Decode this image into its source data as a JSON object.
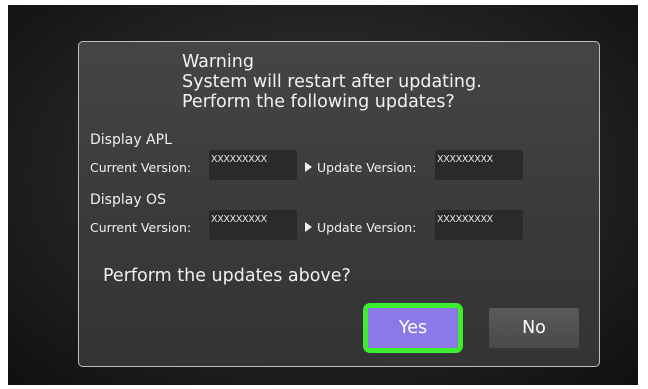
{
  "dialog": {
    "title_lines": [
      "Warning",
      "System will restart after updating.",
      "Perform the following updates?"
    ],
    "sections": [
      {
        "label": "Display APL",
        "current_version_label": "Current Version:",
        "current_version_value": "XXXXXXXXX",
        "update_version_label": "Update Version:",
        "update_version_value": "XXXXXXXXX"
      },
      {
        "label": "Display OS",
        "current_version_label": "Current Version:",
        "current_version_value": "XXXXXXXXX",
        "update_version_label": "Update Version:",
        "update_version_value": "XXXXXXXXX"
      }
    ],
    "question": "Perform the updates above?",
    "yes_label": "Yes",
    "no_label": "No"
  },
  "colors": {
    "yes_button": "#8c78e6",
    "highlight": "#3cee2e",
    "no_button": "#505050",
    "dialog_bg": "#3c3c3c"
  },
  "icons": {
    "arrow": "play-arrow-icon"
  }
}
